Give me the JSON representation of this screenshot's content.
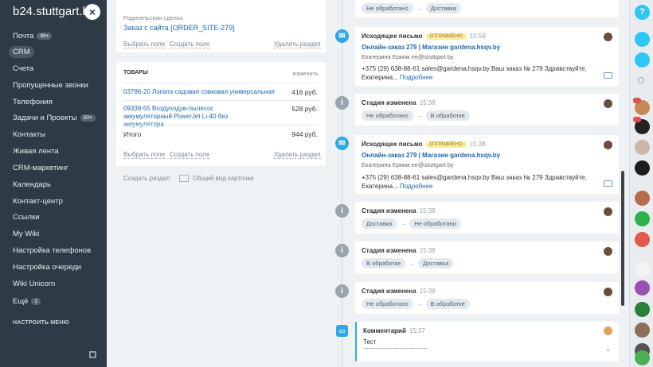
{
  "sidebar": {
    "logo": "b24.stuttgart.by",
    "close_glyph": "×",
    "items": [
      {
        "label": "Почта",
        "badge": "99+"
      },
      {
        "label": "CRM",
        "badge": ""
      },
      {
        "label": "Счета",
        "badge": ""
      },
      {
        "label": "Пропущенные звонки",
        "badge": ""
      },
      {
        "label": "Телефония",
        "badge": ""
      },
      {
        "label": "Задачи и Проекты",
        "badge": "50+"
      },
      {
        "label": "Контакты",
        "badge": ""
      },
      {
        "label": "Живая лента",
        "badge": ""
      },
      {
        "label": "CRM-маркетинг",
        "badge": ""
      },
      {
        "label": "Календарь",
        "badge": ""
      },
      {
        "label": "Контакт-центр",
        "badge": ""
      },
      {
        "label": "Ссылки",
        "badge": ""
      },
      {
        "label": "My Wiki",
        "badge": ""
      },
      {
        "label": "Настройка телефонов",
        "badge": ""
      },
      {
        "label": "Настройка очереди",
        "badge": ""
      },
      {
        "label": "Wiki Unicorn",
        "badge": ""
      },
      {
        "label": "Ещё",
        "badge": "1"
      }
    ],
    "active_index": 1,
    "settings_menu": "НАСТРОИТЬ МЕНЮ"
  },
  "parent_deal": {
    "label": "Родительская сделка",
    "value": "Заказ с сайта [ORDER_SITE-279]",
    "select_field": "Выбрать поле",
    "create_field": "Создать поле",
    "delete_section": "Удалить раздел"
  },
  "products": {
    "header": "ТОВАРЫ",
    "edit": "изменить",
    "items": [
      {
        "name": "03786-20 Лопата садовая совковая универсальная",
        "price": "416 руб."
      },
      {
        "name": "09338-55 Воздуходув-пылесос аккумуляторный PowerJet Li-40 без аккумулятора",
        "price": "528 руб."
      }
    ],
    "total_label": "Итого",
    "total_value": "944 руб.",
    "select_field": "Выбрать поле",
    "create_field": "Создать поле",
    "delete_section": "Удалить раздел"
  },
  "footer_links": {
    "create_section": "Создать раздел",
    "general_view": "Общий вид карточки"
  },
  "timeline": {
    "top_stage": {
      "from": "Не обработано",
      "to": "Доставка"
    },
    "mail1": {
      "title": "Исходящее письмо",
      "status": "ОТПРАВЛЕНО",
      "time": "15:59",
      "subject": "Онлайн-заказ 279 | Магазин gardena.hsqv.by",
      "from": "Екатерина Ермак ee@stuttgart.by",
      "body": "+375 (29) 638-88-61 sales@gardena.hsqv.by Ваш заказ № 279 Здравствуйте, Екатерина...",
      "more": "Подробнее"
    },
    "stage1": {
      "title": "Стадия изменена",
      "time": "15:38",
      "from": "Не обработано",
      "to": "В обработке"
    },
    "mail2": {
      "title": "Исходящее письмо",
      "status": "ОТПРАВЛЕНО",
      "time": "15:38",
      "subject": "Онлайн-заказ 279 | Магазин gardena.hsqv.by",
      "from": "Екатерина Ермак ee@stuttgart.by",
      "body": "+375 (29) 638-88-61 sales@gardena.hsqv.by Ваш заказ № 279 Здравствуйте, Екатерина...",
      "more": "Подробнее"
    },
    "stage2": {
      "title": "Стадия изменена",
      "time": "15:38",
      "from": "Доставка",
      "to": "Не обработано"
    },
    "stage3": {
      "title": "Стадия изменена",
      "time": "15:38",
      "from": "В обработке",
      "to": "Доставка"
    },
    "stage4": {
      "title": "Стадия изменена",
      "time": "15:38",
      "from": "Не обработано",
      "to": "В обработке"
    },
    "comment": {
      "title": "Комментарий",
      "time": "15:37",
      "text": "Тест",
      "dashes": "-----------------------------------"
    }
  },
  "colors": {
    "sidebar_bg": "#2e3b46",
    "link": "#2067b0",
    "sent_badge": "#fdeb9b",
    "mail_icon": "#2fa8e6"
  },
  "icons": [
    "close-icon",
    "info-icon",
    "mail-icon",
    "comment-icon",
    "printer-icon",
    "question-icon",
    "bell-icon",
    "search-icon"
  ]
}
